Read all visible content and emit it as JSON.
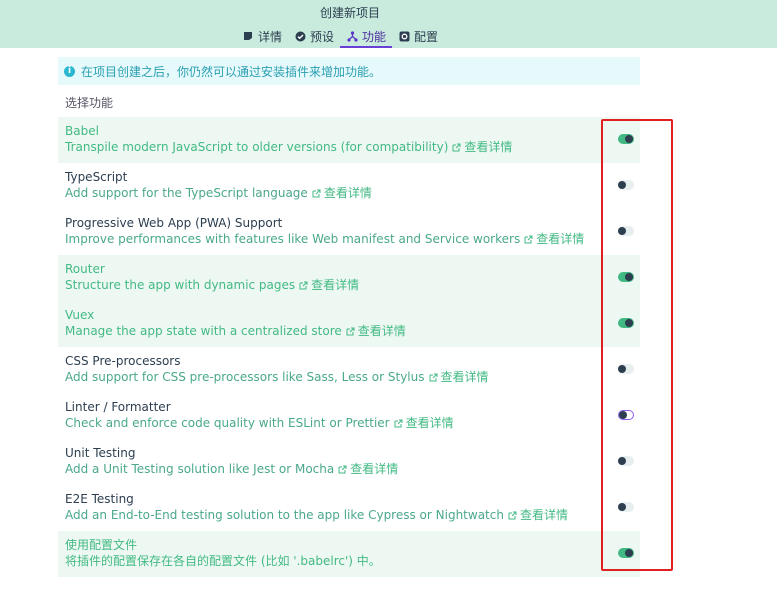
{
  "header": {
    "title": "创建新项目",
    "tabs": [
      {
        "label": "详情",
        "icon": "list-icon",
        "active": false
      },
      {
        "label": "预设",
        "icon": "check-circle-icon",
        "active": false
      },
      {
        "label": "功能",
        "icon": "fork-icon",
        "active": true
      },
      {
        "label": "配置",
        "icon": "settings-icon",
        "active": false
      }
    ]
  },
  "info": {
    "icon": "info-icon",
    "text": "在项目创建之后，你仍然可以通过安装插件来增加功能。"
  },
  "section_label": "选择功能",
  "more_label": "查看详情",
  "features": [
    {
      "name": "Babel",
      "desc": "Transpile modern JavaScript to older versions (for compatibility)",
      "enabled": true
    },
    {
      "name": "TypeScript",
      "desc": "Add support for the TypeScript language",
      "enabled": false
    },
    {
      "name": "Progressive Web App (PWA) Support",
      "desc": "Improve performances with features like Web manifest and Service workers",
      "enabled": false
    },
    {
      "name": "Router",
      "desc": "Structure the app with dynamic pages",
      "enabled": true
    },
    {
      "name": "Vuex",
      "desc": "Manage the app state with a centralized store",
      "enabled": true
    },
    {
      "name": "CSS Pre-processors",
      "desc": "Add support for CSS pre-processors like Sass, Less or Stylus",
      "enabled": false
    },
    {
      "name": "Linter / Formatter",
      "desc": "Check and enforce code quality with ESLint or Prettier",
      "enabled": false,
      "focused": true
    },
    {
      "name": "Unit Testing",
      "desc": "Add a Unit Testing solution like Jest or Mocha",
      "enabled": false
    },
    {
      "name": "E2E Testing",
      "desc": "Add an End-to-End testing solution to the app like Cypress or Nightwatch",
      "enabled": false
    },
    {
      "name": "使用配置文件",
      "desc": "将插件的配置保存在各自的配置文件 (比如 '.babelrc') 中。",
      "enabled": true,
      "no_link": true
    }
  ],
  "colors": {
    "accent": "#42b983",
    "header_bg": "#c8ebdd",
    "info_text": "#2a9fb3",
    "highlight": "#e02020"
  }
}
